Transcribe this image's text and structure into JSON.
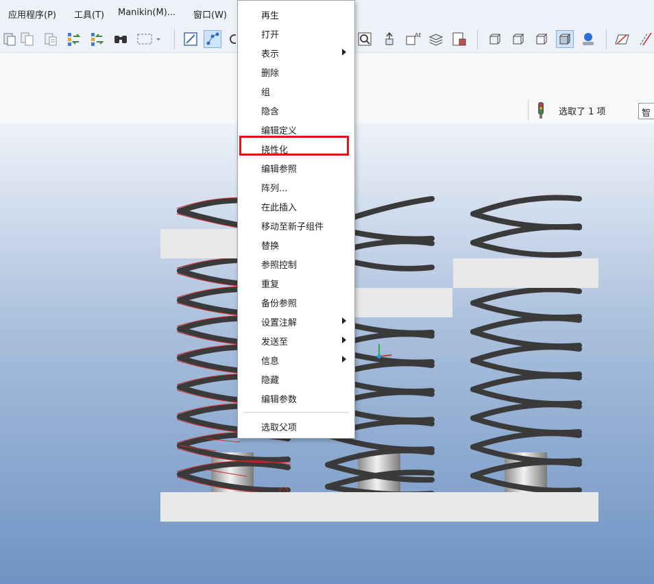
{
  "menubar": {
    "items": [
      "应用程序(P)",
      "工具(T)",
      "Manikin(M)...",
      "窗口(W)"
    ]
  },
  "toolbar": {
    "icons": [
      "paste-icon",
      "copy-icon",
      "copy-special-icon",
      "repaint-icon",
      "regenerate-icon",
      "find-icon",
      "select-box-icon",
      "sketch-icon",
      "datum-point-icon",
      "csys-icon",
      "zoom-window-icon",
      "spin-center-icon",
      "named-view-icon",
      "layers-icon",
      "view-manager-icon",
      "wireframe-icon",
      "hidden-line-icon",
      "no-hidden-icon",
      "shaded-icon",
      "appearance-icon",
      "datum-plane-icon",
      "datum-axis-icon"
    ]
  },
  "status": {
    "selected_text": "选取了 1 项",
    "partial_text": "智"
  },
  "context_menu": {
    "items": [
      {
        "label": "再生"
      },
      {
        "label": "打开"
      },
      {
        "label": "表示",
        "submenu": true
      },
      {
        "label": "删除"
      },
      {
        "label": "组"
      },
      {
        "label": "隐含"
      },
      {
        "label": "编辑定义"
      },
      {
        "label": "挠性化",
        "highlighted": true
      },
      {
        "label": "编辑参照"
      },
      {
        "label": "阵列..."
      },
      {
        "label": "在此插入"
      },
      {
        "label": "移动至新子组件"
      },
      {
        "label": "替换"
      },
      {
        "label": "参照控制"
      },
      {
        "label": "重复"
      },
      {
        "label": "备份参照"
      },
      {
        "label": "设置注解",
        "submenu": true
      },
      {
        "label": "发送至",
        "submenu": true
      },
      {
        "label": "信息",
        "submenu": true
      },
      {
        "label": "隐藏"
      },
      {
        "label": "编辑参数"
      },
      {
        "label": "选取父项"
      }
    ]
  },
  "colors": {
    "highlight_border": "#e01515",
    "selected_spring": "#c0392b",
    "spring": "#3a3a3a"
  }
}
